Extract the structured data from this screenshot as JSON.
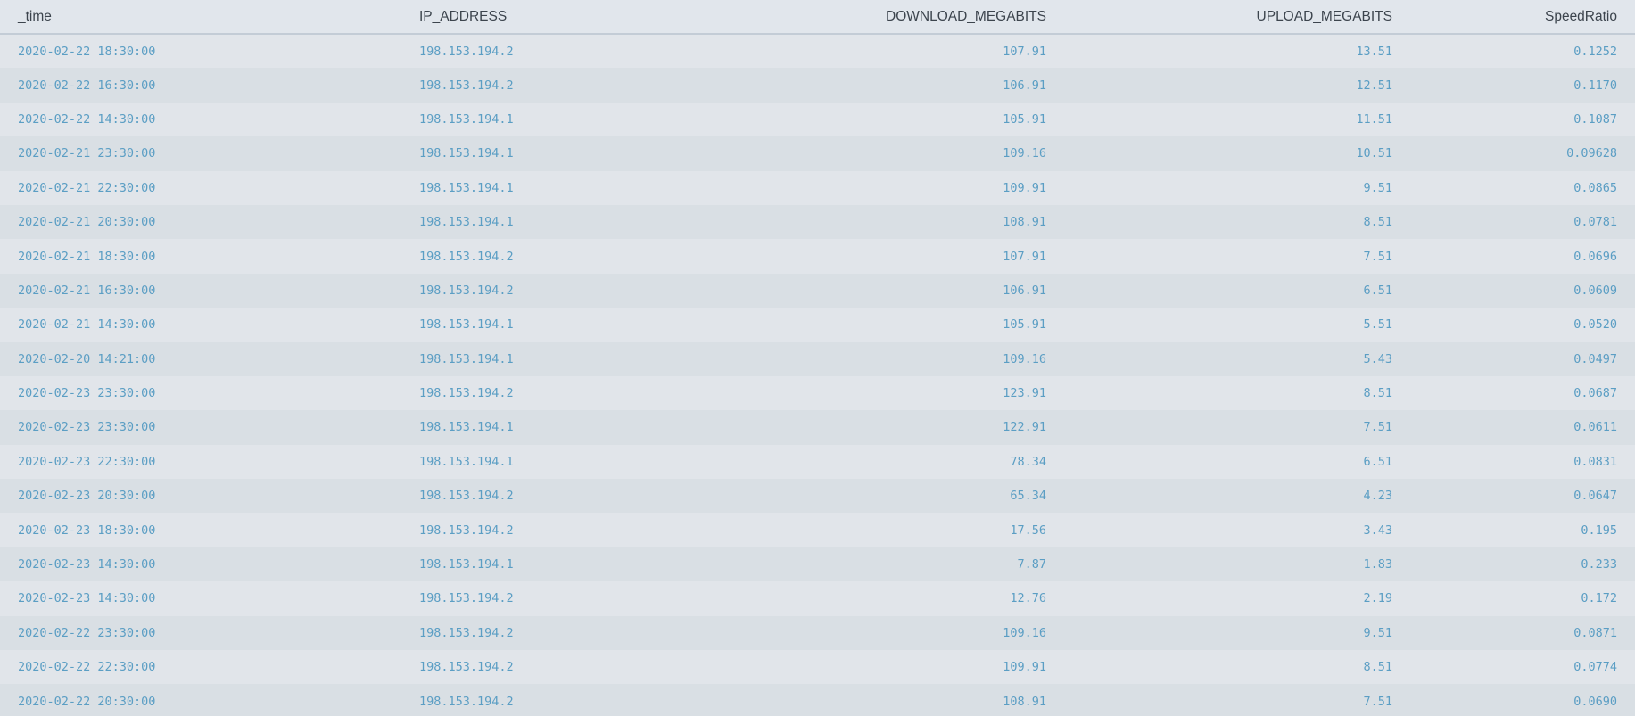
{
  "colors": {
    "header_text": "#3c444d",
    "cell_text": "#5b9ec4",
    "row_odd": "#e1e5ea",
    "row_even": "#d9dfe4"
  },
  "table": {
    "columns": [
      "_time",
      "IP_ADDRESS",
      "DOWNLOAD_MEGABITS",
      "UPLOAD_MEGABITS",
      "SpeedRatio"
    ],
    "rows": [
      [
        "2020-02-22 18:30:00",
        "198.153.194.2",
        "107.91",
        "13.51",
        "0.1252"
      ],
      [
        "2020-02-22 16:30:00",
        "198.153.194.2",
        "106.91",
        "12.51",
        "0.1170"
      ],
      [
        "2020-02-22 14:30:00",
        "198.153.194.1",
        "105.91",
        "11.51",
        "0.1087"
      ],
      [
        "2020-02-21 23:30:00",
        "198.153.194.1",
        "109.16",
        "10.51",
        "0.09628"
      ],
      [
        "2020-02-21 22:30:00",
        "198.153.194.1",
        "109.91",
        "9.51",
        "0.0865"
      ],
      [
        "2020-02-21 20:30:00",
        "198.153.194.1",
        "108.91",
        "8.51",
        "0.0781"
      ],
      [
        "2020-02-21 18:30:00",
        "198.153.194.2",
        "107.91",
        "7.51",
        "0.0696"
      ],
      [
        "2020-02-21 16:30:00",
        "198.153.194.2",
        "106.91",
        "6.51",
        "0.0609"
      ],
      [
        "2020-02-21 14:30:00",
        "198.153.194.1",
        "105.91",
        "5.51",
        "0.0520"
      ],
      [
        "2020-02-20 14:21:00",
        "198.153.194.1",
        "109.16",
        "5.43",
        "0.0497"
      ],
      [
        "2020-02-23 23:30:00",
        "198.153.194.2",
        "123.91",
        "8.51",
        "0.0687"
      ],
      [
        "2020-02-23 23:30:00",
        "198.153.194.1",
        "122.91",
        "7.51",
        "0.0611"
      ],
      [
        "2020-02-23 22:30:00",
        "198.153.194.1",
        "78.34",
        "6.51",
        "0.0831"
      ],
      [
        "2020-02-23 20:30:00",
        "198.153.194.2",
        "65.34",
        "4.23",
        "0.0647"
      ],
      [
        "2020-02-23 18:30:00",
        "198.153.194.2",
        "17.56",
        "3.43",
        "0.195"
      ],
      [
        "2020-02-23 14:30:00",
        "198.153.194.1",
        "7.87",
        "1.83",
        "0.233"
      ],
      [
        "2020-02-23 14:30:00",
        "198.153.194.2",
        "12.76",
        "2.19",
        "0.172"
      ],
      [
        "2020-02-22 23:30:00",
        "198.153.194.2",
        "109.16",
        "9.51",
        "0.0871"
      ],
      [
        "2020-02-22 22:30:00",
        "198.153.194.2",
        "109.91",
        "8.51",
        "0.0774"
      ],
      [
        "2020-02-22 20:30:00",
        "198.153.194.2",
        "108.91",
        "7.51",
        "0.0690"
      ]
    ]
  }
}
